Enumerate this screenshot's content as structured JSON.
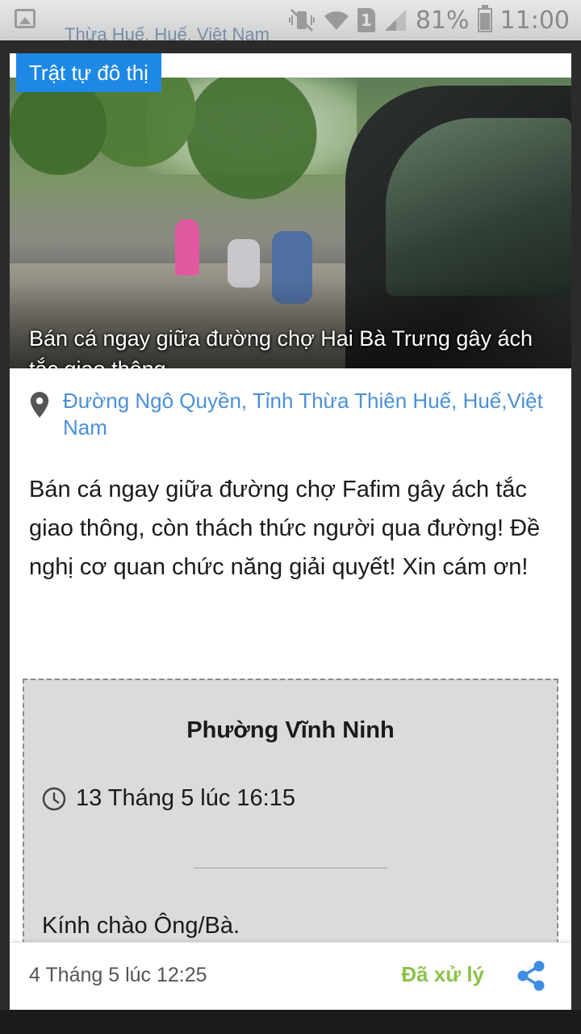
{
  "status_bar": {
    "battery_percent": "81%",
    "time": "11:00",
    "sim_slot": "1",
    "battery_level": 0.81
  },
  "background": {
    "partial_text": "Thừa Huế, Huế, Việt Nam"
  },
  "card": {
    "category": "Trật tự đô thị",
    "photo_title": "Bán cá ngay giữa đường chợ Hai Bà Trưng gây ách tắc giao thông",
    "location": "Đường Ngô Quyền, Tỉnh Thừa Thiên Huế, Huế,Việt Nam",
    "description": "Bán cá ngay giữa đường chợ Fafim gây ách tắc giao thông, còn thách thức người qua đường! Đề nghị cơ quan chức năng giải quyết! Xin cám ơn!",
    "reply": {
      "department": "Phường Vĩnh Ninh",
      "time": "13 Tháng 5 lúc 16:15",
      "greeting": "Kính chào Ông/Bà."
    },
    "footer": {
      "date": "4 Tháng 5 lúc 12:25",
      "status": "Đã xử lý"
    }
  },
  "colors": {
    "category_bg": "#1e88e5",
    "link": "#4a90d9",
    "status_done": "#8bc34a",
    "share": "#3d8de0"
  }
}
